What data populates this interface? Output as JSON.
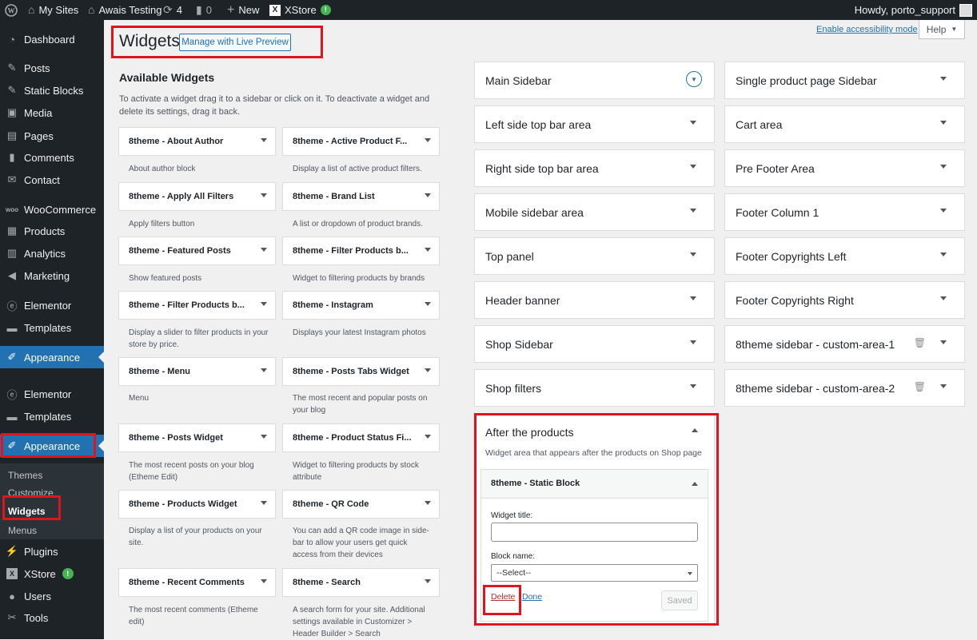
{
  "admin_bar": {
    "my_sites": "My Sites",
    "site_name": "Awais Testing",
    "updates_count": "4",
    "comments_count": "0",
    "new_label": "New",
    "xstore_label": "XStore",
    "greeting": "Howdy, porto_support"
  },
  "sidebar": {
    "items": [
      {
        "label": "Dashboard",
        "icon": "dashboard-icon"
      },
      {
        "label": "Posts",
        "icon": "pin-icon"
      },
      {
        "label": "Static Blocks",
        "icon": "pin-icon"
      },
      {
        "label": "Media",
        "icon": "media-icon"
      },
      {
        "label": "Pages",
        "icon": "pages-icon"
      },
      {
        "label": "Comments",
        "icon": "comment-icon"
      },
      {
        "label": "Contact",
        "icon": "mail-icon"
      },
      {
        "label": "WooCommerce",
        "icon": "woo-icon"
      },
      {
        "label": "Products",
        "icon": "products-icon"
      },
      {
        "label": "Analytics",
        "icon": "analytics-icon"
      },
      {
        "label": "Marketing",
        "icon": "megaphone-icon"
      },
      {
        "label": "Elementor",
        "icon": "elementor-icon"
      },
      {
        "label": "Templates",
        "icon": "folder-icon"
      },
      {
        "label": "Appearance",
        "icon": "brush-icon"
      },
      {
        "label": "Elementor",
        "icon": "elementor-icon"
      },
      {
        "label": "Templates",
        "icon": "folder-icon"
      },
      {
        "label": "Appearance",
        "icon": "brush-icon"
      },
      {
        "label": "Plugins",
        "icon": "plugin-icon"
      },
      {
        "label": "XStore",
        "icon": "xstore-icon",
        "badge": "!"
      },
      {
        "label": "Users",
        "icon": "users-icon"
      },
      {
        "label": "Tools",
        "icon": "wrench-icon"
      }
    ],
    "submenu": [
      "Themes",
      "Customize",
      "Widgets",
      "Menus"
    ]
  },
  "header": {
    "title": "Widgets",
    "live_preview_button": "Manage with Live Preview",
    "accessibility_link": "Enable accessibility mode",
    "help_button": "Help"
  },
  "available": {
    "title": "Available Widgets",
    "description": "To activate a widget drag it to a sidebar or click on it. To deactivate a widget and delete its settings, drag it back.",
    "left": [
      {
        "name": "8theme - About Author",
        "desc": "About author block"
      },
      {
        "name": "8theme - Apply All Filters",
        "desc": "Apply filters button"
      },
      {
        "name": "8theme - Featured Posts",
        "desc": "Show featured posts"
      },
      {
        "name": "8theme - Filter Products b...",
        "desc": "Display a slider to filter products in your store by price."
      },
      {
        "name": "8theme - Menu",
        "desc": "Menu"
      },
      {
        "name": "8theme - Posts Widget",
        "desc": "The most recent posts on your blog (Etheme Edit)"
      },
      {
        "name": "8theme - Products Widget",
        "desc": "Display a list of your products on your site."
      },
      {
        "name": "8theme - Recent Comments",
        "desc": "The most recent comments (Etheme edit)"
      }
    ],
    "right": [
      {
        "name": "8theme - Active Product F...",
        "desc": "Display a list of active product filters."
      },
      {
        "name": "8theme - Brand List",
        "desc": "A list or dropdown of product brands."
      },
      {
        "name": "8theme - Filter Products b...",
        "desc": "Widget to filtering products by brands"
      },
      {
        "name": "8theme - Instagram",
        "desc": "Displays your latest Instagram photos"
      },
      {
        "name": "8theme - Posts Tabs Widget",
        "desc": "The most recent and popular posts on your blog"
      },
      {
        "name": "8theme - Product Status Fi...",
        "desc": "Widget to filtering products by stock attribute"
      },
      {
        "name": "8theme - QR Code",
        "desc": "You can add a QR code image in side-bar to allow your users get quick access from their devices"
      },
      {
        "name": "8theme - Search",
        "desc": "A search form for your site. Additional settings available in Customizer > Header Builder > Search"
      }
    ]
  },
  "areas": {
    "col1": [
      "Main Sidebar",
      "Left side top bar area",
      "Right side top bar area",
      "Mobile sidebar area",
      "Top panel",
      "Header banner",
      "Shop Sidebar",
      "Shop filters"
    ],
    "col2": [
      "Single product page Sidebar",
      "Cart area",
      "Pre Footer Area",
      "Footer Column 1",
      "Footer Copyrights Left",
      "Footer Copyrights Right",
      "8theme sidebar - custom-area-1",
      "8theme sidebar - custom-area-2"
    ]
  },
  "open_area": {
    "title": "After the products",
    "description": "Widget area that appears after the products on Shop page",
    "widget": {
      "title": "8theme - Static Block",
      "widget_title_label": "Widget title:",
      "widget_title_value": "",
      "block_name_label": "Block name:",
      "block_name_value": "--Select--",
      "delete": "Delete",
      "done": "Done",
      "saved": "Saved"
    }
  }
}
